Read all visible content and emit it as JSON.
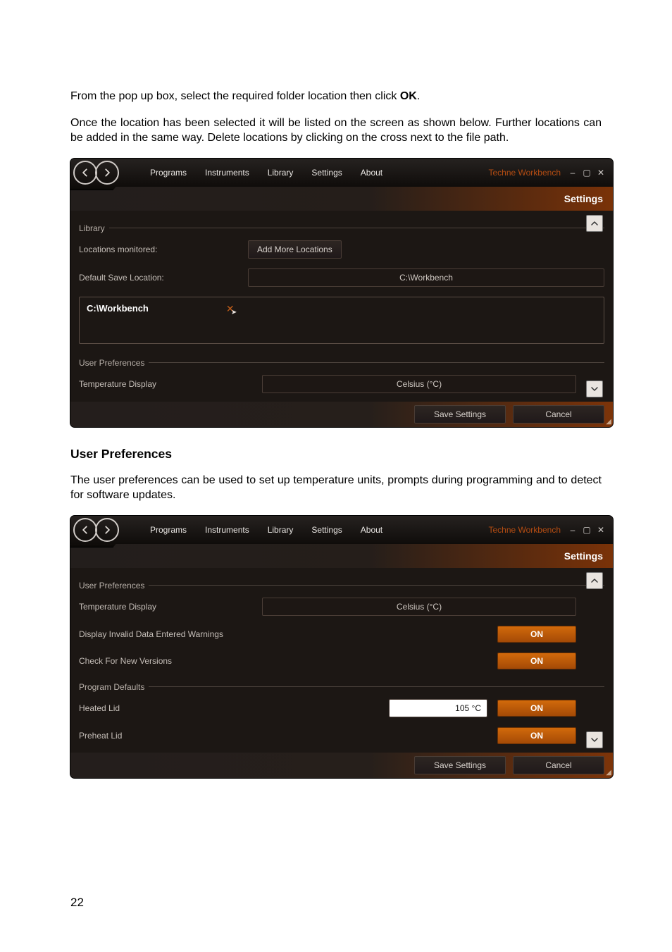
{
  "intro": {
    "line1a": "From the pop up box, select the required folder location then click ",
    "ok": "OK",
    "line1b": ".",
    "line2": "Once the location has been selected it will be listed on the screen as shown below. Further locations can be added in the same way. Delete locations by clicking on the cross next to the file path."
  },
  "tabs": [
    "Programs",
    "Instruments",
    "Library",
    "Settings",
    "About"
  ],
  "window_title": "Techne Workbench",
  "page_heading": "Settings",
  "shot1": {
    "section_library": "Library",
    "locations_monitored": "Locations monitored:",
    "add_more_locations": "Add More Locations",
    "default_save_location": "Default Save Location:",
    "default_save_value": "C:\\Workbench",
    "path1": "C:\\Workbench",
    "section_userprefs": "User Preferences",
    "temperature_display": "Temperature Display",
    "temperature_value": "Celsius (°C)"
  },
  "mid": {
    "heading": "User Preferences",
    "paragraph": "The user preferences can be used to set up temperature units, prompts during programming and to detect for software updates."
  },
  "shot2": {
    "section_userprefs": "User Preferences",
    "temperature_display": "Temperature Display",
    "temperature_value": "Celsius (°C)",
    "display_invalid": "Display Invalid Data Entered Warnings",
    "check_versions": "Check For New Versions",
    "section_program_defaults": "Program Defaults",
    "heated_lid": "Heated Lid",
    "heated_lid_value": "105 °C",
    "preheat_lid": "Preheat Lid",
    "on": "ON"
  },
  "footer": {
    "save": "Save Settings",
    "cancel": "Cancel"
  },
  "page_number": "22"
}
